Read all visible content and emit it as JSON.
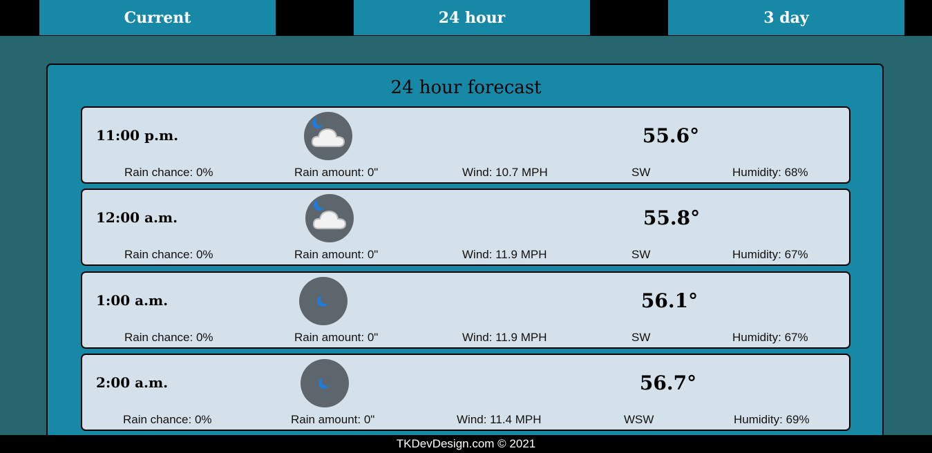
{
  "nav": {
    "tabs": [
      "Current",
      "24 hour",
      "3 day"
    ]
  },
  "forecast": {
    "title": "24 hour forecast",
    "hours": [
      {
        "time": "11:00 p.m.",
        "icon": "partly-cloudy-night-icon",
        "temp": "55.6°",
        "rain_chance": "Rain chance: 0%",
        "rain_amount": "Rain amount: 0\"",
        "wind": "Wind: 10.7 MPH",
        "dir": "SW",
        "humidity": "Humidity: 68%"
      },
      {
        "time": "12:00 a.m.",
        "icon": "partly-cloudy-night-icon",
        "temp": "55.8°",
        "rain_chance": "Rain chance: 0%",
        "rain_amount": "Rain amount: 0\"",
        "wind": "Wind: 11.9 MPH",
        "dir": "SW",
        "humidity": "Humidity: 67%"
      },
      {
        "time": "1:00 a.m.",
        "icon": "clear-night-moon-icon",
        "temp": "56.1°",
        "rain_chance": "Rain chance: 0%",
        "rain_amount": "Rain amount: 0\"",
        "wind": "Wind: 11.9 MPH",
        "dir": "SW",
        "humidity": "Humidity: 67%"
      },
      {
        "time": "2:00 a.m.",
        "icon": "clear-night-moon-icon",
        "temp": "56.7°",
        "rain_chance": "Rain chance: 0%",
        "rain_amount": "Rain amount: 0\"",
        "wind": "Wind: 11.4 MPH",
        "dir": "WSW",
        "humidity": "Humidity: 69%"
      }
    ]
  },
  "footer": {
    "text": "TKDevDesign.com © 2021"
  }
}
